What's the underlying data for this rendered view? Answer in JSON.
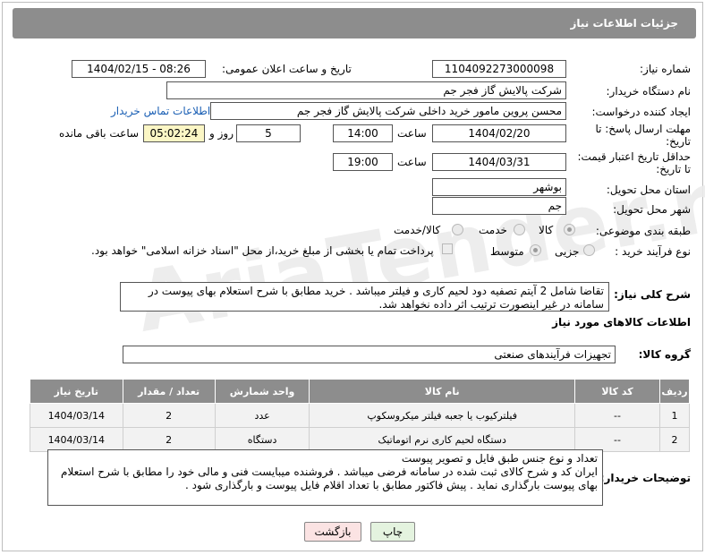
{
  "header": {
    "title": "جزئیات اطلاعات نیاز"
  },
  "watermark": "AriaTender.net",
  "fields": {
    "need_number_label": "شماره نیاز:",
    "need_number": "1104092273000098",
    "announce_label": "تاریخ و ساعت اعلان عمومی:",
    "announce_value": "1404/02/15 - 08:26",
    "buyer_org_label": "نام دستگاه خریدار:",
    "buyer_org": "شرکت پالایش گاز فجر جم",
    "requester_label": "ایجاد کننده درخواست:",
    "requester": "محسن پروین مامور خرید داخلی شرکت پالایش گاز فجر جم",
    "contact_link": "اطلاعات تماس خریدار",
    "reply_deadline_label_1": "مهلت ارسال پاسخ: تا",
    "reply_deadline_label_2": "تاریخ:",
    "reply_date": "1404/02/20",
    "time_label": "ساعت",
    "reply_time": "14:00",
    "days_value": "5",
    "days_label": "روز و",
    "remaining_time": "05:02:24",
    "remaining_label": "ساعت باقی مانده",
    "price_validity_label_1": "حداقل تاریخ اعتبار قیمت:",
    "price_validity_label_2": "تا تاریخ:",
    "validity_date": "1404/03/31",
    "validity_time": "19:00",
    "province_label": "استان محل تحویل:",
    "province": "بوشهر",
    "city_label": "شهر محل تحویل:",
    "city": "جم",
    "category_label": "طبقه بندی موضوعی:",
    "category_options": [
      "کالا",
      "خدمت",
      "کالا/خدمت"
    ],
    "category_selected": "کالا",
    "process_label": "نوع فرآیند خرید :",
    "process_options": [
      "جزیی",
      "متوسط"
    ],
    "process_selected": "متوسط",
    "payment_note": "پرداخت تمام یا بخشی از مبلغ خرید،از محل \"اسناد خزانه اسلامی\" خواهد بود."
  },
  "description": {
    "label": "شرح کلی نیاز:",
    "text": "تقاضا شامل 2  آیتم تصفیه دود لحیم کاری و فیلتر میباشد  . خرید مطابق با شرح استعلام بهای پیوست در سامانه در غیر اینصورت ترتیب اثر داده نخواهد شد."
  },
  "goods_section": {
    "title": "اطلاعات کالاهای مورد نیاز",
    "group_label": "گروه کالا:",
    "group_value": "تجهیزات فرآیندهای صنعتی"
  },
  "table": {
    "headers": [
      "ردیف",
      "کد کالا",
      "نام کالا",
      "واحد شمارش",
      "تعداد / مقدار",
      "تاریخ نیاز"
    ],
    "rows": [
      [
        "1",
        "--",
        "فیلترکیوب یا جعبه فیلتر میکروسکوپ",
        "عدد",
        "2",
        "1404/03/14"
      ],
      [
        "2",
        "--",
        "دستگاه لحیم کاری نرم اتوماتیک",
        "دستگاه",
        "2",
        "1404/03/14"
      ]
    ]
  },
  "buyer_notes": {
    "label": "توضیحات خریدار:",
    "lines": [
      "تعداد و نوع جنس طبق فایل و تصویر پیوست",
      "ایران کد و شرح کالای ثبت شده در سامانه فرضی میباشد . فروشنده میبایست فنی و مالی خود را مطابق با شرح استعلام بهای پیوست بارگذاری نماید . پیش فاکتور مطابق با تعداد اقلام فایل پیوست و بارگذاری شود ."
    ]
  },
  "buttons": {
    "print": "چاپ",
    "back": "بازگشت"
  },
  "colors": {
    "header_bg": "#8d8d8d",
    "back_btn_bg": "#fbe3e3",
    "print_btn_bg": "#e4f3df",
    "link": "#1a5fb4"
  }
}
